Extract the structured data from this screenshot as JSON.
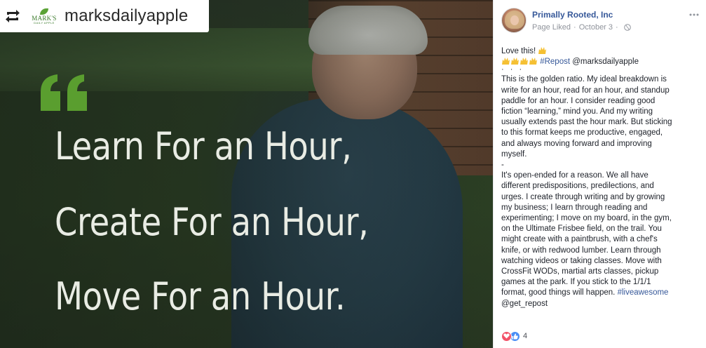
{
  "photo": {
    "account_name": "marksdailyapple",
    "brand_logo": {
      "name": "MARK'S",
      "sub": "DAILY APPLE",
      "icon": "apple-leaf-logo"
    },
    "repost_icon": "repost-icon",
    "quote": {
      "lines": [
        "Learn For an Hour,",
        "Create For an Hour,",
        "Move For an Hour."
      ],
      "mark_color": "#5a9e2f"
    }
  },
  "post": {
    "page_name": "Primally Rooted, Inc",
    "status": "Page Liked",
    "date": "October 3",
    "separator": "·",
    "lines": {
      "l1": "Love this!",
      "l2_link": "#Repost",
      "l2_rest": " @marksdailyapple",
      "l3": "This is the golden ratio. My ideal breakdown is",
      "l4": "write for an hour, read for an hour, and standup",
      "l5": "paddle for an hour. I consider reading good",
      "l6": "fiction “learning,” mind you. And my writing",
      "l7": "usually extends past the hour mark. But sticking",
      "l8": "to this format keeps me productive, engaged,",
      "l9": "and always moving forward and improving",
      "l10": "myself.",
      "l11": "-",
      "l12": "It's open-ended for a reason. We all have",
      "l13": "different predispositions, predilections, and",
      "l14": "urges. I create through writing and by growing",
      "l15": "my business; I learn through reading and",
      "l16": "experimenting; I move on my board, in the gym,",
      "l17": "on the Ultimate Frisbee field, on the trail. You",
      "l18": "might create with a paintbrush, with a chef's",
      "l19": "knife, or with redwood lumber. Learn through",
      "l20": "watching videos or taking classes. Move with",
      "l21": "CrossFit WODs, martial arts classes, pickup",
      "l22": "games at the park. If you stick to the 1/1/1",
      "l23a": "format, good things will happen. ",
      "l23_link": "#liveawesome",
      "l24": "@get_repost"
    },
    "reactions": {
      "count": "4",
      "types": [
        "love-icon",
        "like-icon"
      ]
    },
    "colors": {
      "link": "#365899",
      "text": "#1d2129",
      "meta": "#90949c"
    }
  }
}
